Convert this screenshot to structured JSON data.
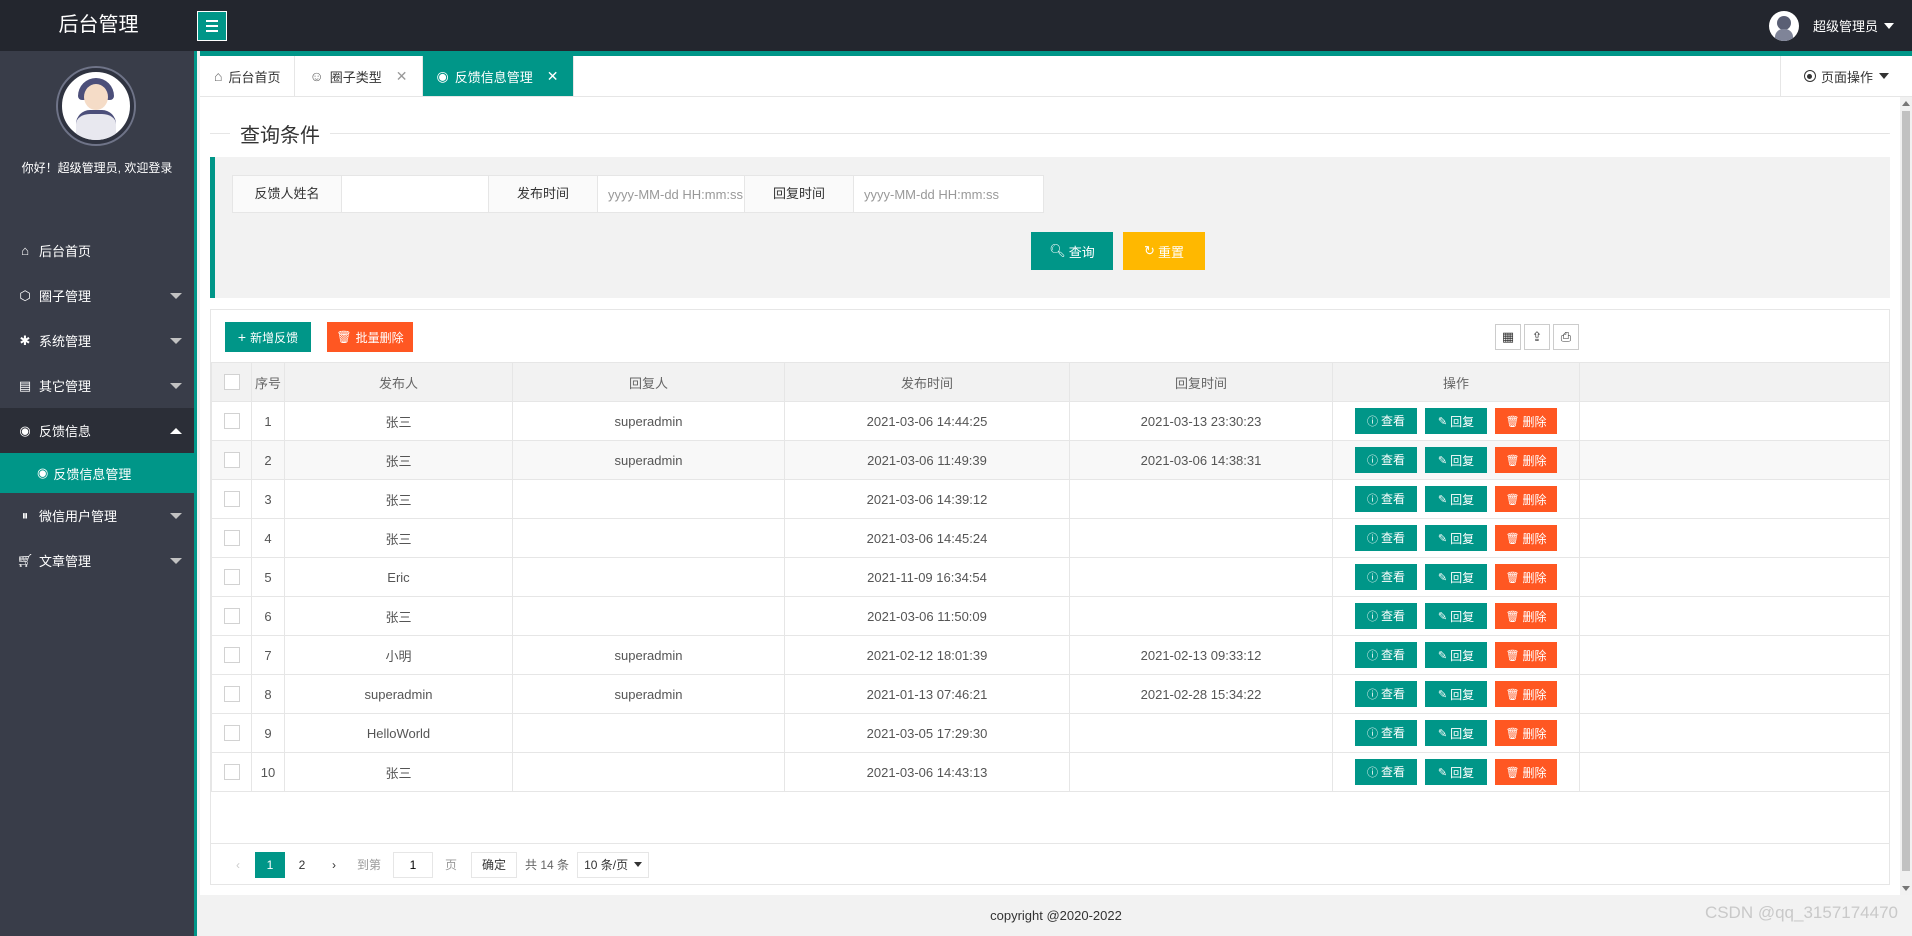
{
  "header": {
    "logo": "后台管理",
    "user_name": "超级管理员"
  },
  "sidebar": {
    "welcome": "你好！超级管理员, 欢迎登录",
    "items": [
      {
        "label": "后台首页",
        "icon": "home-icon"
      },
      {
        "label": "圈子管理",
        "icon": "cube-icon"
      },
      {
        "label": "系统管理",
        "icon": "gear-icon"
      },
      {
        "label": "其它管理",
        "icon": "clipboard-icon"
      },
      {
        "label": "反馈信息",
        "icon": "feedback-icon"
      },
      {
        "label": "微信用户管理",
        "icon": "pause-circle-icon"
      },
      {
        "label": "文章管理",
        "icon": "cart-icon"
      }
    ],
    "sub_item": {
      "label": "反馈信息管理",
      "icon": "feedback-icon"
    }
  },
  "tabs": [
    {
      "label": "后台首页",
      "icon": "home-icon"
    },
    {
      "label": "圈子类型",
      "icon": "user-icon"
    },
    {
      "label": "反馈信息管理",
      "icon": "feedback-icon"
    }
  ],
  "page_ops": "页面操作",
  "query": {
    "title": "查询条件",
    "fields": [
      {
        "label": "反馈人姓名",
        "placeholder": ""
      },
      {
        "label": "发布时间",
        "placeholder": "yyyy-MM-dd HH:mm:ss"
      },
      {
        "label": "回复时间",
        "placeholder": "yyyy-MM-dd HH:mm:ss"
      }
    ],
    "search_label": "查询",
    "reset_label": "重置"
  },
  "toolbar": {
    "add_label": "新增反馈",
    "batch_delete_label": "批量删除"
  },
  "table": {
    "columns": [
      "序号",
      "发布人",
      "回复人",
      "发布时间",
      "回复时间",
      "操作"
    ],
    "rows": [
      {
        "no": "1",
        "publisher": "张三",
        "replier": "superadmin",
        "publish_time": "2021-03-06 14:44:25",
        "reply_time": "2021-03-13 23:30:23"
      },
      {
        "no": "2",
        "publisher": "张三",
        "replier": "superadmin",
        "publish_time": "2021-03-06 11:49:39",
        "reply_time": "2021-03-06 14:38:31"
      },
      {
        "no": "3",
        "publisher": "张三",
        "replier": "",
        "publish_time": "2021-03-06 14:39:12",
        "reply_time": ""
      },
      {
        "no": "4",
        "publisher": "张三",
        "replier": "",
        "publish_time": "2021-03-06 14:45:24",
        "reply_time": ""
      },
      {
        "no": "5",
        "publisher": "Eric",
        "replier": "",
        "publish_time": "2021-11-09 16:34:54",
        "reply_time": ""
      },
      {
        "no": "6",
        "publisher": "张三",
        "replier": "",
        "publish_time": "2021-03-06 11:50:09",
        "reply_time": ""
      },
      {
        "no": "7",
        "publisher": "小明",
        "replier": "superadmin",
        "publish_time": "2021-02-12 18:01:39",
        "reply_time": "2021-02-13 09:33:12"
      },
      {
        "no": "8",
        "publisher": "superadmin",
        "replier": "superadmin",
        "publish_time": "2021-01-13 07:46:21",
        "reply_time": "2021-02-28 15:34:22"
      },
      {
        "no": "9",
        "publisher": "HelloWorld",
        "replier": "",
        "publish_time": "2021-03-05 17:29:30",
        "reply_time": ""
      },
      {
        "no": "10",
        "publisher": "张三",
        "replier": "",
        "publish_time": "2021-03-06 14:43:13",
        "reply_time": ""
      }
    ],
    "row_actions": {
      "view": "查看",
      "reply": "回复",
      "delete": "删除"
    }
  },
  "pager": {
    "pages": [
      "1",
      "2"
    ],
    "current": "1",
    "goto_label": "到第",
    "goto_value": "1",
    "page_unit": "页",
    "confirm_label": "确定",
    "total_label": "共 14 条",
    "page_size": "10 条/页"
  },
  "footer": "copyright @2020-2022",
  "watermark": "CSDN @qq_3157174470",
  "colors": {
    "accent": "#009688",
    "warning": "#ffb800",
    "danger": "#ff5722",
    "sidebar": "#393d49",
    "header": "#23262e"
  }
}
